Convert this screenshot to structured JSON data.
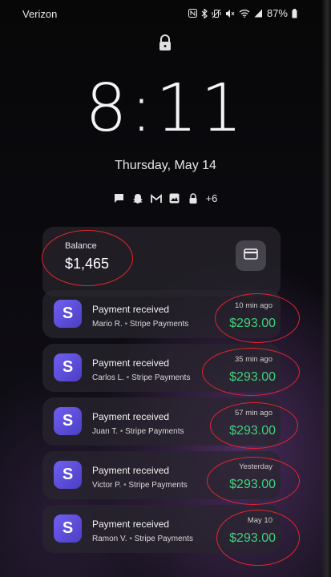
{
  "status_bar": {
    "carrier": "Verizon",
    "battery": "87%",
    "icons": [
      "nfc-icon",
      "bluetooth-icon",
      "vibrate-icon",
      "mute-icon",
      "wifi-icon",
      "signal-icon",
      "battery-icon"
    ]
  },
  "lock_screen": {
    "time": "8:11",
    "date": "Thursday, May 14",
    "notification_icons": [
      "message-icon",
      "snapchat-icon",
      "gmail-icon",
      "gallery-icon",
      "lock-icon"
    ],
    "more_count": "+6"
  },
  "balance": {
    "label": "Balance",
    "amount": "$1,465"
  },
  "payments": [
    {
      "title": "Payment received",
      "name": "Mario R.",
      "source": "Stripe Payments",
      "time": "10 min ago",
      "amount": "$293.00"
    },
    {
      "title": "Payment received",
      "name": "Carlos L.",
      "source": "Stripe Payments",
      "time": "35 min ago",
      "amount": "$293.00"
    },
    {
      "title": "Payment received",
      "name": "Juan T.",
      "source": "Stripe Payments",
      "time": "57 min ago",
      "amount": "$293.00"
    },
    {
      "title": "Payment received",
      "name": "Victor P.",
      "source": "Stripe Payments",
      "time": "Yesterday",
      "amount": "$293.00"
    },
    {
      "title": "Payment received",
      "name": "Ramon V.",
      "source": "Stripe Payments",
      "time": "May 10",
      "amount": "$293.00"
    }
  ],
  "app_icon_letter": "S",
  "colors": {
    "accent_green": "#3fd27a",
    "stripe_purple": "#635bff",
    "annotation_red": "#e3262f"
  }
}
